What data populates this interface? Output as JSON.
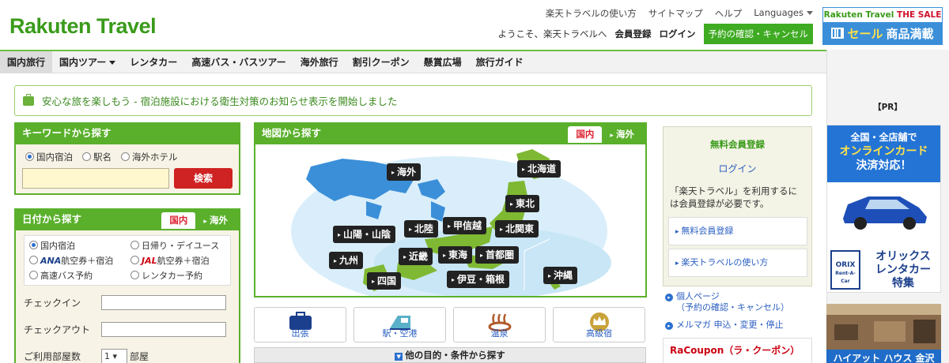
{
  "logo": "Rakuten Travel",
  "top_links": [
    "楽天トラベルの使い方",
    "サイトマップ",
    "ヘルプ",
    "Languages"
  ],
  "user_row": {
    "welcome": "ようこそ、楽天トラベルへ",
    "register": "会員登録",
    "login": "ログイン",
    "reservation": "予約の確認・キャンセル"
  },
  "sale_banner": {
    "brand": "Rakuten Travel",
    "brand_sale": "THE SALE",
    "text_a": "セール",
    "text_b": "商品満載"
  },
  "nav": [
    "国内旅行",
    "国内ツアー",
    "レンタカー",
    "高速バス・バスツアー",
    "海外旅行",
    "割引クーポン",
    "懸賞広場",
    "旅行ガイド"
  ],
  "notice": "安心な旅を楽しもう - 宿泊施設における衛生対策のお知らせ表示を開始しました",
  "keyword": {
    "title": "キーワードから探す",
    "options": [
      "国内宿泊",
      "駅名",
      "海外ホテル"
    ],
    "search_button": "検索"
  },
  "date": {
    "title": "日付から探す",
    "tab_domestic": "国内",
    "tab_overseas": "海外",
    "options": [
      {
        "brand": "",
        "text": "国内宿泊"
      },
      {
        "brand": "",
        "text": "日帰り・デイユース"
      },
      {
        "brand": "ANA",
        "text": "航空券＋宿泊"
      },
      {
        "brand": "JAL",
        "text": "航空券＋宿泊"
      },
      {
        "brand": "",
        "text": "高速バス予約"
      },
      {
        "brand": "",
        "text": "レンタカー予約"
      }
    ],
    "checkin": "チェックイン",
    "checkout": "チェックアウト",
    "rooms_label": "ご利用部屋数",
    "rooms_value": "1",
    "rooms_unit": "部屋"
  },
  "map": {
    "title": "地図から探す",
    "tab_domestic": "国内",
    "tab_overseas": "海外",
    "regions": [
      "海外",
      "北海道",
      "東北",
      "北関東",
      "甲信越",
      "北陸",
      "山陽・山陰",
      "九州",
      "近畿",
      "東海",
      "首都圏",
      "四国",
      "伊豆・箱根",
      "沖縄"
    ]
  },
  "categories": [
    "出張",
    "駅・空港",
    "温泉",
    "高級宿"
  ],
  "other_conditions": "他の目的・条件から探す",
  "member": {
    "title": "無料会員登録",
    "login": "ログイン",
    "desc": "「楽天トラベル」を利用するには会員登録が必要です。",
    "links": [
      "無料会員登録",
      "楽天トラベルの使い方"
    ],
    "bottom_links": [
      "個人ページ",
      "（予約の確認・キャンセル）",
      "メルマガ 申込・変更・停止"
    ],
    "racoupon": "RaCoupon（ラ・クーポン）"
  },
  "ads": {
    "pr": "【PR】",
    "ad1_lines": [
      "全国・全店舗で",
      "オンラインカード",
      "決済対応！"
    ],
    "ad1_orix": "ORIX",
    "ad1_orix_sub": "Rent-A-Car",
    "ad1_company": [
      "オリックス",
      "レンタカー",
      "特集"
    ],
    "ad2_caption": "ハイアット ハウス 金沢"
  },
  "colors": {
    "brand_green": "#3a9b1a",
    "box_green": "#5ab02b",
    "search_red": "#cf2222",
    "link_blue": "#2a5ec0",
    "map_sea": "#d9eefa",
    "land": "#7fb832"
  }
}
